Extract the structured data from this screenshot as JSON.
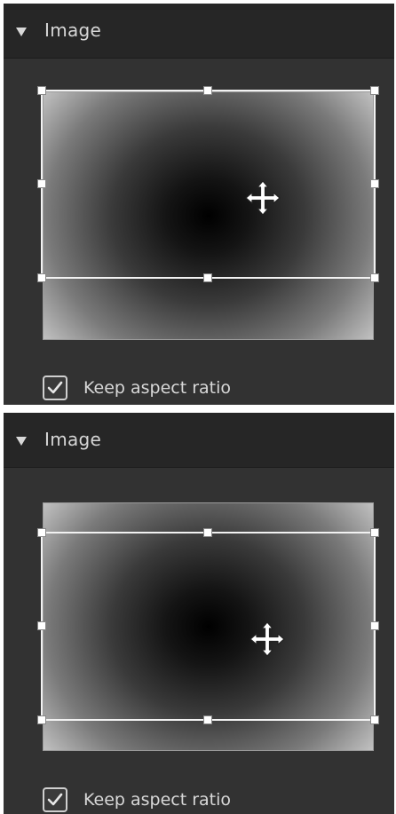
{
  "panels": [
    {
      "header": {
        "title": "Image",
        "expanded": true,
        "icon": "collapse-triangle-icon"
      },
      "crop": {
        "handles": 8,
        "move_icon": "move-cross-icon"
      },
      "options": {
        "keep_aspect_ratio_label": "Keep aspect ratio",
        "keep_aspect_ratio_checked": true
      }
    },
    {
      "header": {
        "title": "Image",
        "expanded": true,
        "icon": "collapse-triangle-icon"
      },
      "crop": {
        "handles": 8,
        "move_icon": "move-cross-icon"
      },
      "options": {
        "keep_aspect_ratio_label": "Keep aspect ratio",
        "keep_aspect_ratio_checked": true
      }
    }
  ],
  "colors": {
    "panel_bg": "#323232",
    "header_bg": "#262626",
    "text": "#d6d6d6",
    "crop_border": "#f2f2f2"
  }
}
